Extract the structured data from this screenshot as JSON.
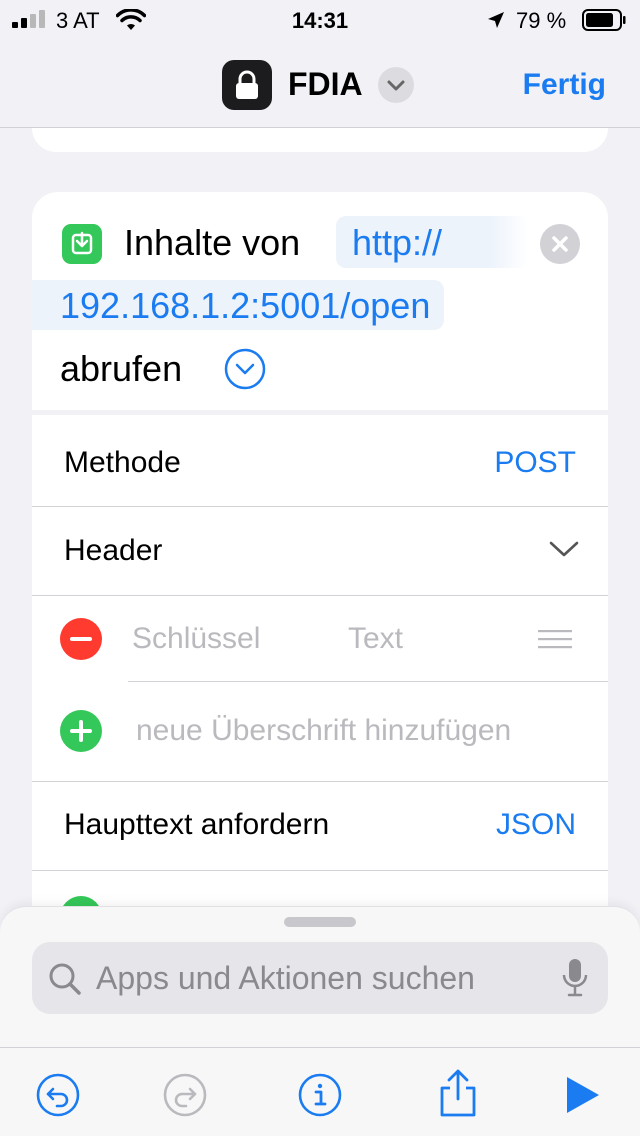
{
  "status_bar": {
    "carrier": "3 AT",
    "time": "14:31",
    "battery": "79 %"
  },
  "nav": {
    "title": "FDIA",
    "done": "Fertig"
  },
  "action": {
    "label": "Inhalte von",
    "url_part1": "http://",
    "url_part2": "192.168.1.2:5001/open",
    "tail": "abrufen"
  },
  "rows": {
    "method_label": "Methode",
    "method_value": "POST",
    "header_label": "Header",
    "key_placeholder": "Schlüssel",
    "text_placeholder": "Text",
    "add_header": "neue Überschrift hinzufügen",
    "body_label": "Haupttext anfordern",
    "body_value": "JSON"
  },
  "search": {
    "placeholder": "Apps und Aktionen suchen"
  },
  "colors": {
    "accent": "#1a7cf0",
    "green": "#34c759",
    "red": "#ff3b30"
  }
}
